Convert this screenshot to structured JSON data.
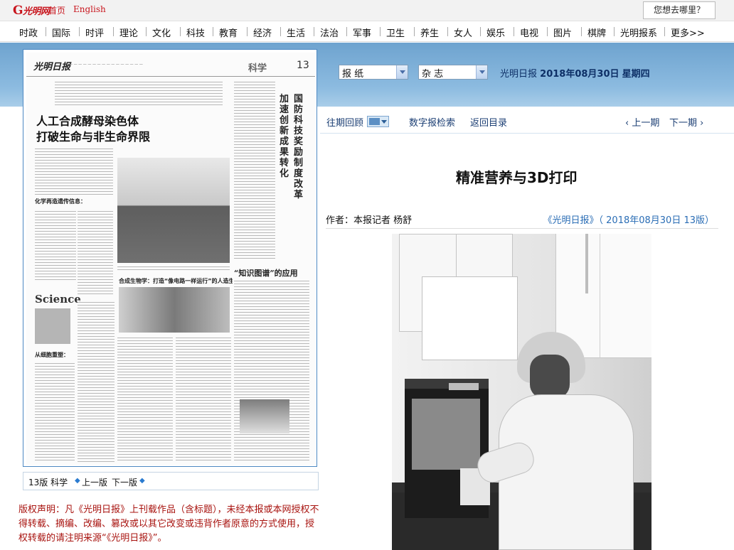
{
  "topbar": {
    "logo": "光明网",
    "home": "首页",
    "english": "English",
    "where_button": "您想去哪里？"
  },
  "nav": {
    "items": [
      "时政",
      "国际",
      "时评",
      "理论",
      "文化",
      "科技",
      "教育",
      "经济",
      "生活",
      "法治",
      "军事",
      "卫生",
      "养生",
      "女人",
      "娱乐",
      "电视",
      "图片",
      "棋牌",
      "光明报系",
      "更多>>"
    ]
  },
  "paper": {
    "masthead": "光明日报",
    "section": "科学",
    "page_number": "13",
    "headline_line1": "人工合成酵母染色体",
    "headline_line2": "打破生命与非生命界限",
    "side_headline_a": "国防科技奖励制度改革",
    "side_headline_b": "加速创新成果转化",
    "subhead_1": "化学再造遗传信息：",
    "subhead_2": "合成生物学：打造“像电路一样运行”的人造生物系统",
    "subhead_3": "从细胞重塑：",
    "knowledge_title": "“知识图谱”的应用",
    "science_cover": "Science"
  },
  "pager": {
    "current": "13版 科学",
    "prev": "上一版",
    "next": "下一版"
  },
  "copyright": "版权声明：凡《光明日报》上刊载作品（含标题），未经本报或本网授权不得转载、摘编、改编、篡改或以其它改变或违背作者原意的方式使用，授权转载的请注明来源“《光明日报》”。",
  "selectors": {
    "newspaper": "报 纸",
    "magazine": "杂 志"
  },
  "dateline": {
    "paper": "光明日报",
    "date": "2018年08月30日",
    "weekday": "星期四"
  },
  "toolbar": {
    "past_issues": "往期回顾",
    "digital_search": "数字报检索",
    "back_to_index": "返回目录",
    "prev_issue": "上一期",
    "next_issue": "下一期"
  },
  "article": {
    "title": "精准营养与3D打印",
    "author": "作者：本报记者 杨舒",
    "source": "《光明日报》（ 2018年08月30日 13版）"
  },
  "colors": {
    "brand_red": "#c8151d",
    "band_blue": "#8cbbe0",
    "link_blue": "#2a6db5",
    "copyright_red": "#a8130f"
  }
}
